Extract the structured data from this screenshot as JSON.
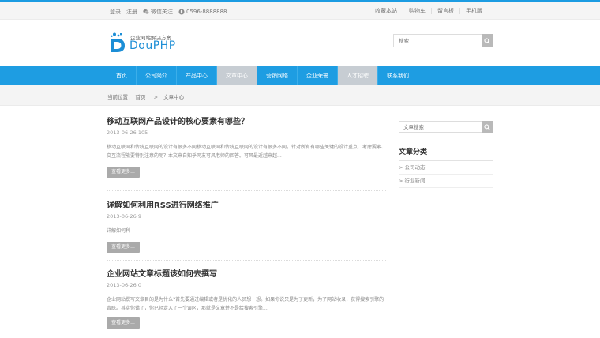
{
  "topbar": {
    "login": "登录",
    "register": "注册",
    "wechat": "微信关注",
    "phone": "0596-8888888",
    "favorite": "收藏本站",
    "cart": "购物车",
    "guestbook": "留言板",
    "mobile": "手机版"
  },
  "header": {
    "slogan": "企业网站解决方案",
    "brand": "DouPHP",
    "search_placeholder": "搜索"
  },
  "nav": {
    "items": [
      {
        "label": "首页"
      },
      {
        "label": "公司简介"
      },
      {
        "label": "产品中心"
      },
      {
        "label": "文章中心"
      },
      {
        "label": "营销网络"
      },
      {
        "label": "企业荣誉"
      },
      {
        "label": "人才招聘"
      },
      {
        "label": "联系我们"
      }
    ],
    "active_index": 3
  },
  "breadcrumb": {
    "prefix": "当前位置：",
    "home": "首页",
    "sep": ">",
    "current": "文章中心"
  },
  "articles": [
    {
      "title": "移动互联网产品设计的核心要素有哪些？",
      "meta": "2013-06-26  105",
      "desc": "移动互联网和传统互联网的设计有很多不同移动互联网和传统互联网的设计有很多不同，针对所有有哪些关键的设计重点、考虑要素、交互流程能要特别注意的呢？本文来自知乎网友可风老师的回答。可风最近越来越...",
      "more": "查看更多..."
    },
    {
      "title": "详解如何利用RSS进行网络推广",
      "meta": "2013-06-26  9",
      "desc": "详解如何利",
      "more": "查看更多..."
    },
    {
      "title": "企业网站文章标题该如何去撰写",
      "meta": "2013-06-26  0",
      "desc": "企业网站撰写文章目的是为什么?首先要通过编辑或者是优化的人员想一想。如果你说只是为了更新，为了网站收录，获得搜索引擎的青睐。其实你错了，你已经走入了一个误区，那就是文章并不是给搜索引擎...",
      "more": "查看更多..."
    }
  ],
  "sidebar": {
    "search_placeholder": "文章搜索",
    "title": "文章分类",
    "categories": [
      {
        "label": "> 公司动态"
      },
      {
        "label": "> 行业新闻"
      }
    ]
  },
  "colors": {
    "accent": "#1e9de2",
    "active_nav": "#c7cdd3",
    "button_gray": "#aaaaaa"
  }
}
